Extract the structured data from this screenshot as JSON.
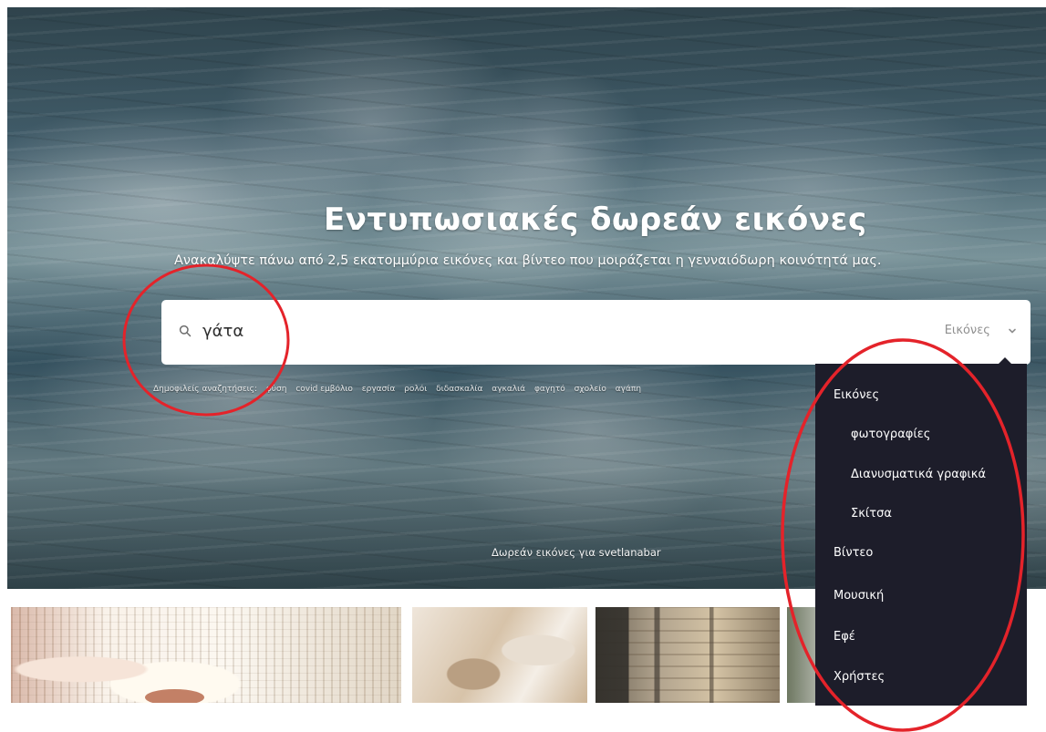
{
  "hero": {
    "title": "Εντυπωσιακές δωρεάν εικόνες",
    "subtitle": "Ανακαλύψτε πάνω από 2,5 εκατομμύρια εικόνες και βίντεο που μοιράζεται η γενναιόδωρη κοινότητά μας.",
    "free_images_text": "Δωρεάν εικόνες για svetlanabar"
  },
  "search": {
    "value": "γάτα",
    "icon": "search-icon",
    "type_label": "Εικόνες",
    "type_icon": "chevron-down-icon"
  },
  "popular_searches": {
    "label": "Δημοφιλείς αναζητήσεις:",
    "terms": [
      "φύση",
      "covid εμβόλιο",
      "εργασία",
      "ρολόι",
      "διδασκαλία",
      "αγκαλιά",
      "φαγητό",
      "σχολείο",
      "αγάπη"
    ]
  },
  "dropdown": {
    "items": [
      {
        "label": "Εικόνες",
        "level": 0
      },
      {
        "label": "φωτογραφίες",
        "level": 1
      },
      {
        "label": "Διανυσματικά γραφικά",
        "level": 1
      },
      {
        "label": "Σκίτσα",
        "level": 1
      },
      {
        "label": "Βίντεο",
        "level": 0
      },
      {
        "label": "Μουσική",
        "level": 0
      },
      {
        "label": "Εφέ",
        "level": 0
      },
      {
        "label": "Χρήστες",
        "level": 0
      }
    ]
  },
  "colors": {
    "annotation": "#e4232a",
    "dropdown_background": "#1d1d2a",
    "search_background": "#ffffff"
  }
}
